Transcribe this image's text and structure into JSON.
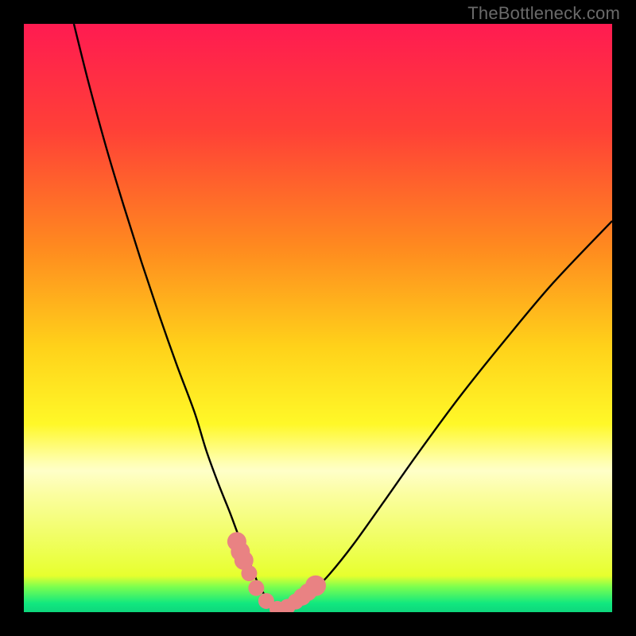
{
  "watermark": "TheBottleneck.com",
  "chart_data": {
    "type": "line",
    "title": "",
    "xlabel": "",
    "ylabel": "",
    "xlim": [
      0,
      100
    ],
    "ylim": [
      0,
      100
    ],
    "grid": false,
    "legend": false,
    "gradient_stops": [
      {
        "offset": 0.0,
        "color": "#ff1b51"
      },
      {
        "offset": 0.18,
        "color": "#ff4037"
      },
      {
        "offset": 0.38,
        "color": "#ff8a1f"
      },
      {
        "offset": 0.55,
        "color": "#ffd21a"
      },
      {
        "offset": 0.68,
        "color": "#fff828"
      },
      {
        "offset": 0.745,
        "color": "#ffffb0"
      },
      {
        "offset": 0.76,
        "color": "#ffffc8"
      },
      {
        "offset": 0.8,
        "color": "#fbfea0"
      },
      {
        "offset": 0.938,
        "color": "#e7ff2e"
      },
      {
        "offset": 0.957,
        "color": "#7cff4f"
      },
      {
        "offset": 0.985,
        "color": "#11e87f"
      },
      {
        "offset": 1.0,
        "color": "#0ed67c"
      }
    ],
    "series": [
      {
        "name": "bottleneck-curve",
        "x": [
          8.5,
          11,
          14,
          17,
          20,
          23,
          26,
          29,
          31,
          33,
          35,
          36.5,
          38,
          39,
          40,
          41,
          42,
          43.5,
          45,
          47,
          49,
          52,
          56,
          61,
          67,
          74,
          82,
          90,
          100
        ],
        "values": [
          100,
          90,
          79,
          69,
          59.5,
          50.5,
          42,
          34,
          27.5,
          22,
          17,
          13,
          9.5,
          6.8,
          4.5,
          2.8,
          1.4,
          0.5,
          0.6,
          1.6,
          3.4,
          6.5,
          11.5,
          18.5,
          27,
          36.5,
          46.5,
          56,
          66.5
        ]
      }
    ],
    "markers": {
      "name": "highlight-points",
      "color": "#e98283",
      "x": [
        36.2,
        36.8,
        37.4,
        38.3,
        39.5,
        41.2,
        43.1,
        44.8,
        46.2,
        47.3,
        48.3,
        49.6
      ],
      "values": [
        12.0,
        10.3,
        8.8,
        6.6,
        4.1,
        1.9,
        0.55,
        0.9,
        1.8,
        2.6,
        3.4,
        4.5
      ],
      "radius": [
        12,
        12,
        12,
        10,
        10,
        10,
        10,
        10,
        10,
        11,
        11,
        13
      ]
    }
  }
}
